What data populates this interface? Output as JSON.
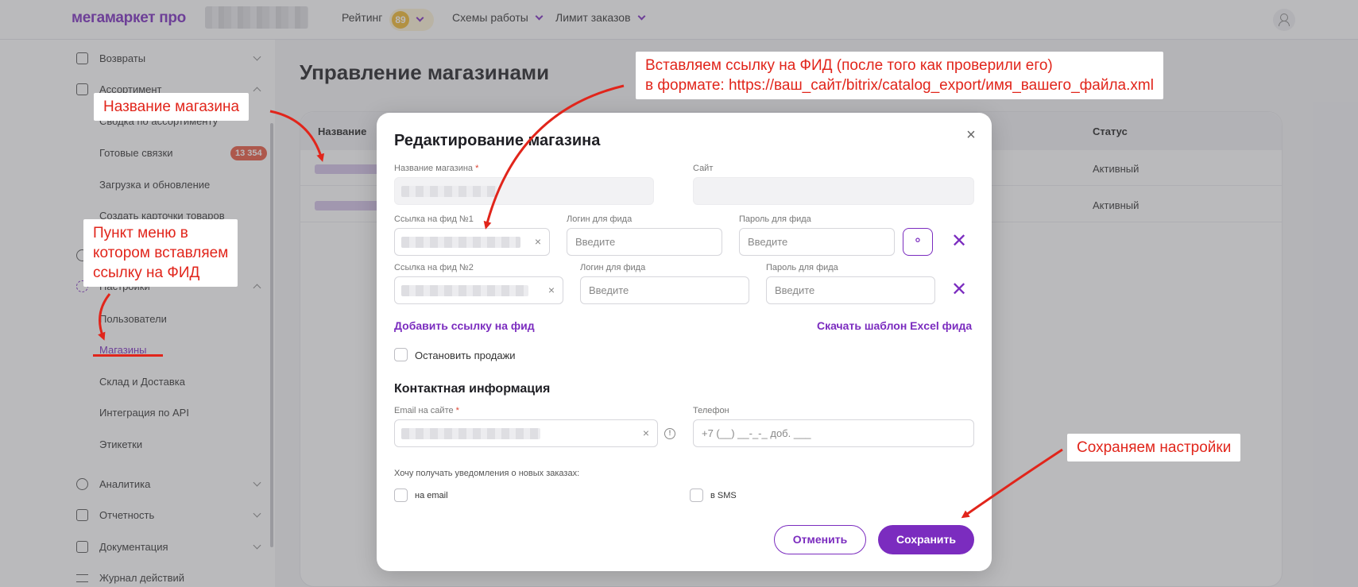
{
  "topbar": {
    "logo": "мегамаркет про",
    "rating_label": "Рейтинг",
    "rating_value": "89",
    "schemes_label": "Схемы работы",
    "limit_label": "Лимит заказов"
  },
  "sidebar": {
    "returns": "Возвраты",
    "assortment": "Ассортимент",
    "summary": "Сводка по ассортименту",
    "ready_links": "Готовые связки",
    "ready_links_badge": "13 354",
    "upload": "Загрузка и обновление",
    "create_cards": "Создать карточки товаров",
    "settings": "Настройки",
    "users": "Пользователи",
    "shops": "Магазины",
    "warehouse": "Склад и Доставка",
    "api": "Интеграция по API",
    "labels": "Этикетки",
    "analytics": "Аналитика",
    "reports": "Отчетность",
    "documents": "Документация",
    "journal": "Журнал действий"
  },
  "main": {
    "title": "Управление магазинами",
    "col_name": "Название",
    "col_status": "Статус",
    "rows": [
      {
        "status": "Активный"
      },
      {
        "status": "Активный"
      }
    ]
  },
  "modal": {
    "title": "Редактирование магазина",
    "close": "×",
    "shop_name_label": "Название магазина",
    "required_mark": "*",
    "site_label": "Сайт",
    "feed1_label": "Ссылка на фид №1",
    "feed2_label": "Ссылка на фид №2",
    "login_label": "Логин для фида",
    "password_label": "Пароль для фида",
    "placeholder_enter": "Введите",
    "clear": "×",
    "add_feed": "Добавить ссылку на фид",
    "download_template": "Скачать шаблон Excel фида",
    "stop_sales": "Остановить продажи",
    "contact_title": "Контактная информация",
    "email_label": "Email на сайте",
    "phone_label": "Телефон",
    "phone_placeholder": "+7 (__) __-_-_ доб. ___",
    "notify_hint": "Хочу получать уведомления о новых заказах:",
    "notify_email": "на email",
    "notify_sms": "в SMS",
    "cancel": "Отменить",
    "save": "Сохранить"
  },
  "annotations": {
    "shop_name": "Название магазина",
    "menu_item": [
      "Пункт меню в",
      "котором вставляем",
      "ссылку на ФИД"
    ],
    "feed_link": [
      "Вставляем ссылку на ФИД (после того как проверили его)",
      "в формате: https://ваш_сайт/bitrix/catalog_export/имя_вашего_файла.xml"
    ],
    "save_settings": "Сохраняем настройки",
    "color": "#e1251b"
  }
}
